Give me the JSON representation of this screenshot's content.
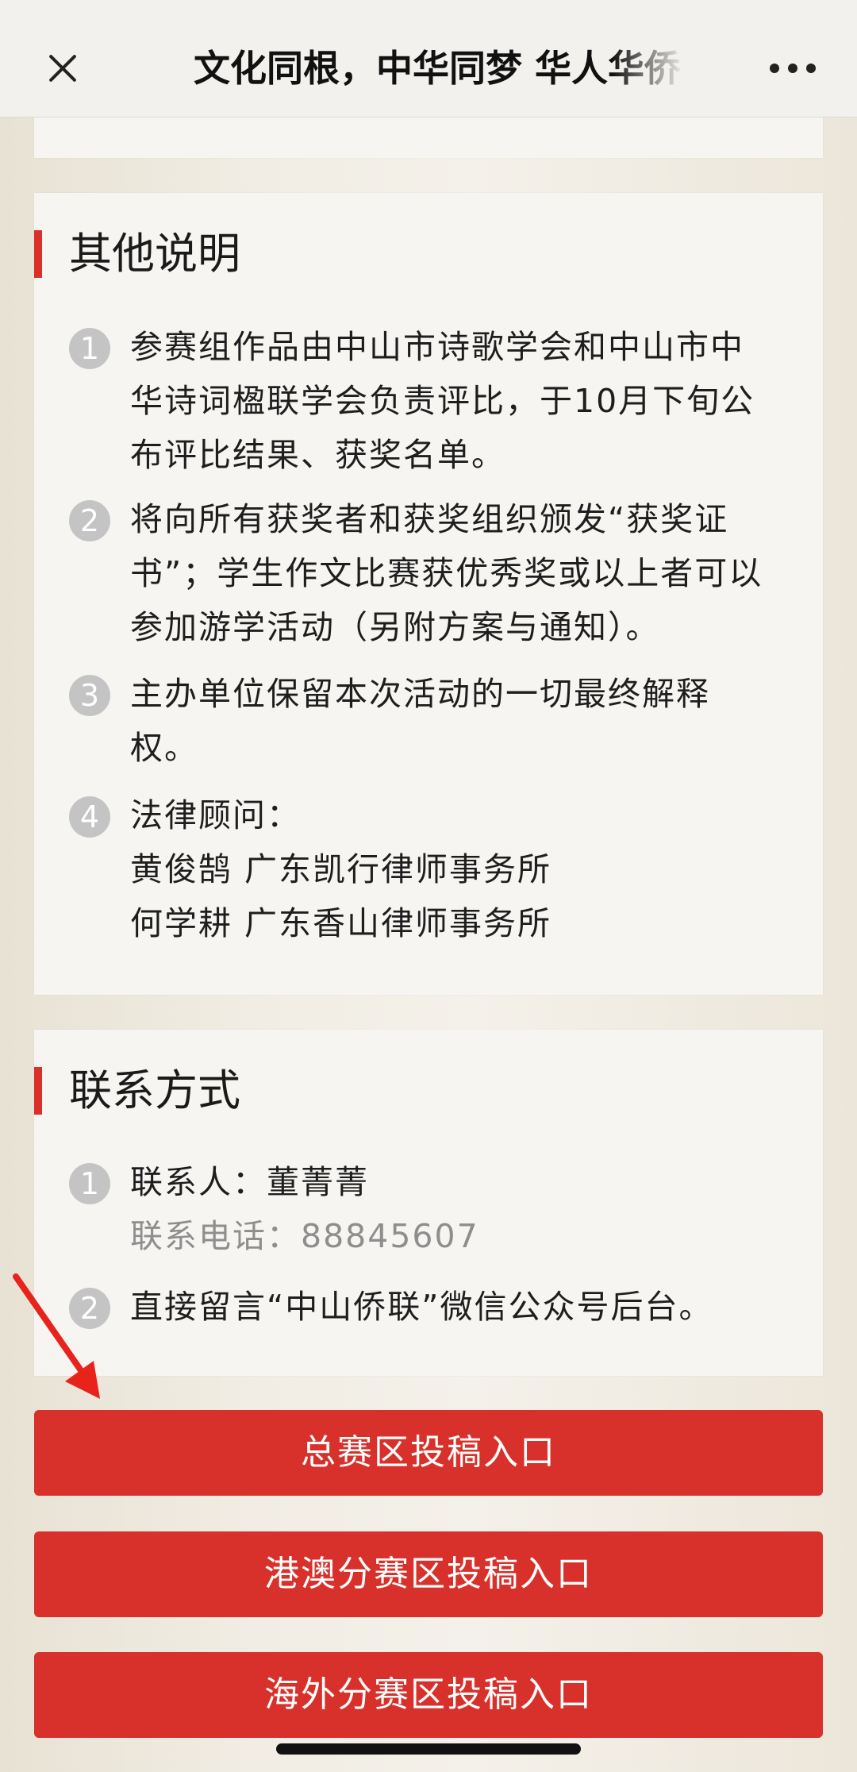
{
  "header": {
    "title": "文化同根，中华同梦 华人华侨"
  },
  "other_notes": {
    "title": "其他说明",
    "items": [
      {
        "num": "1",
        "lines": [
          "参赛组作品由中山市诗歌学会和中山市中",
          "华诗词楹联学会负责评比，于10月下旬公",
          "布评比结果、获奖名单。"
        ]
      },
      {
        "num": "2",
        "lines": [
          "将向所有获奖者和获奖组织颁发“获奖证",
          "书”；学生作文比赛获优秀奖或以上者可以",
          "参加游学活动（另附方案与通知）。"
        ]
      },
      {
        "num": "3",
        "lines": [
          "主办单位保留本次活动的一切最终解释",
          "权。"
        ]
      },
      {
        "num": "4",
        "lines": [
          "法律顾问：",
          "黄俊鹄 广东凯行律师事务所",
          "何学耕 广东香山律师事务所"
        ]
      }
    ]
  },
  "contact": {
    "title": "联系方式",
    "items": [
      {
        "num": "1",
        "lines": [
          "联系人：董菁菁",
          "联系电话：88845607"
        ]
      },
      {
        "num": "2",
        "lines": [
          "直接留言“中山侨联”微信公众号后台。"
        ]
      }
    ]
  },
  "buttons": {
    "main": "总赛区投稿入口",
    "hk_macau": "港澳分赛区投稿入口",
    "overseas": "海外分赛区投稿入口"
  },
  "colors": {
    "accent_red": "#d8302a",
    "badge_grey": "#c4c4c4"
  },
  "icons": {
    "close": "close-icon",
    "more": "more-dots-icon",
    "pointer": "red-arrow-annotation"
  }
}
